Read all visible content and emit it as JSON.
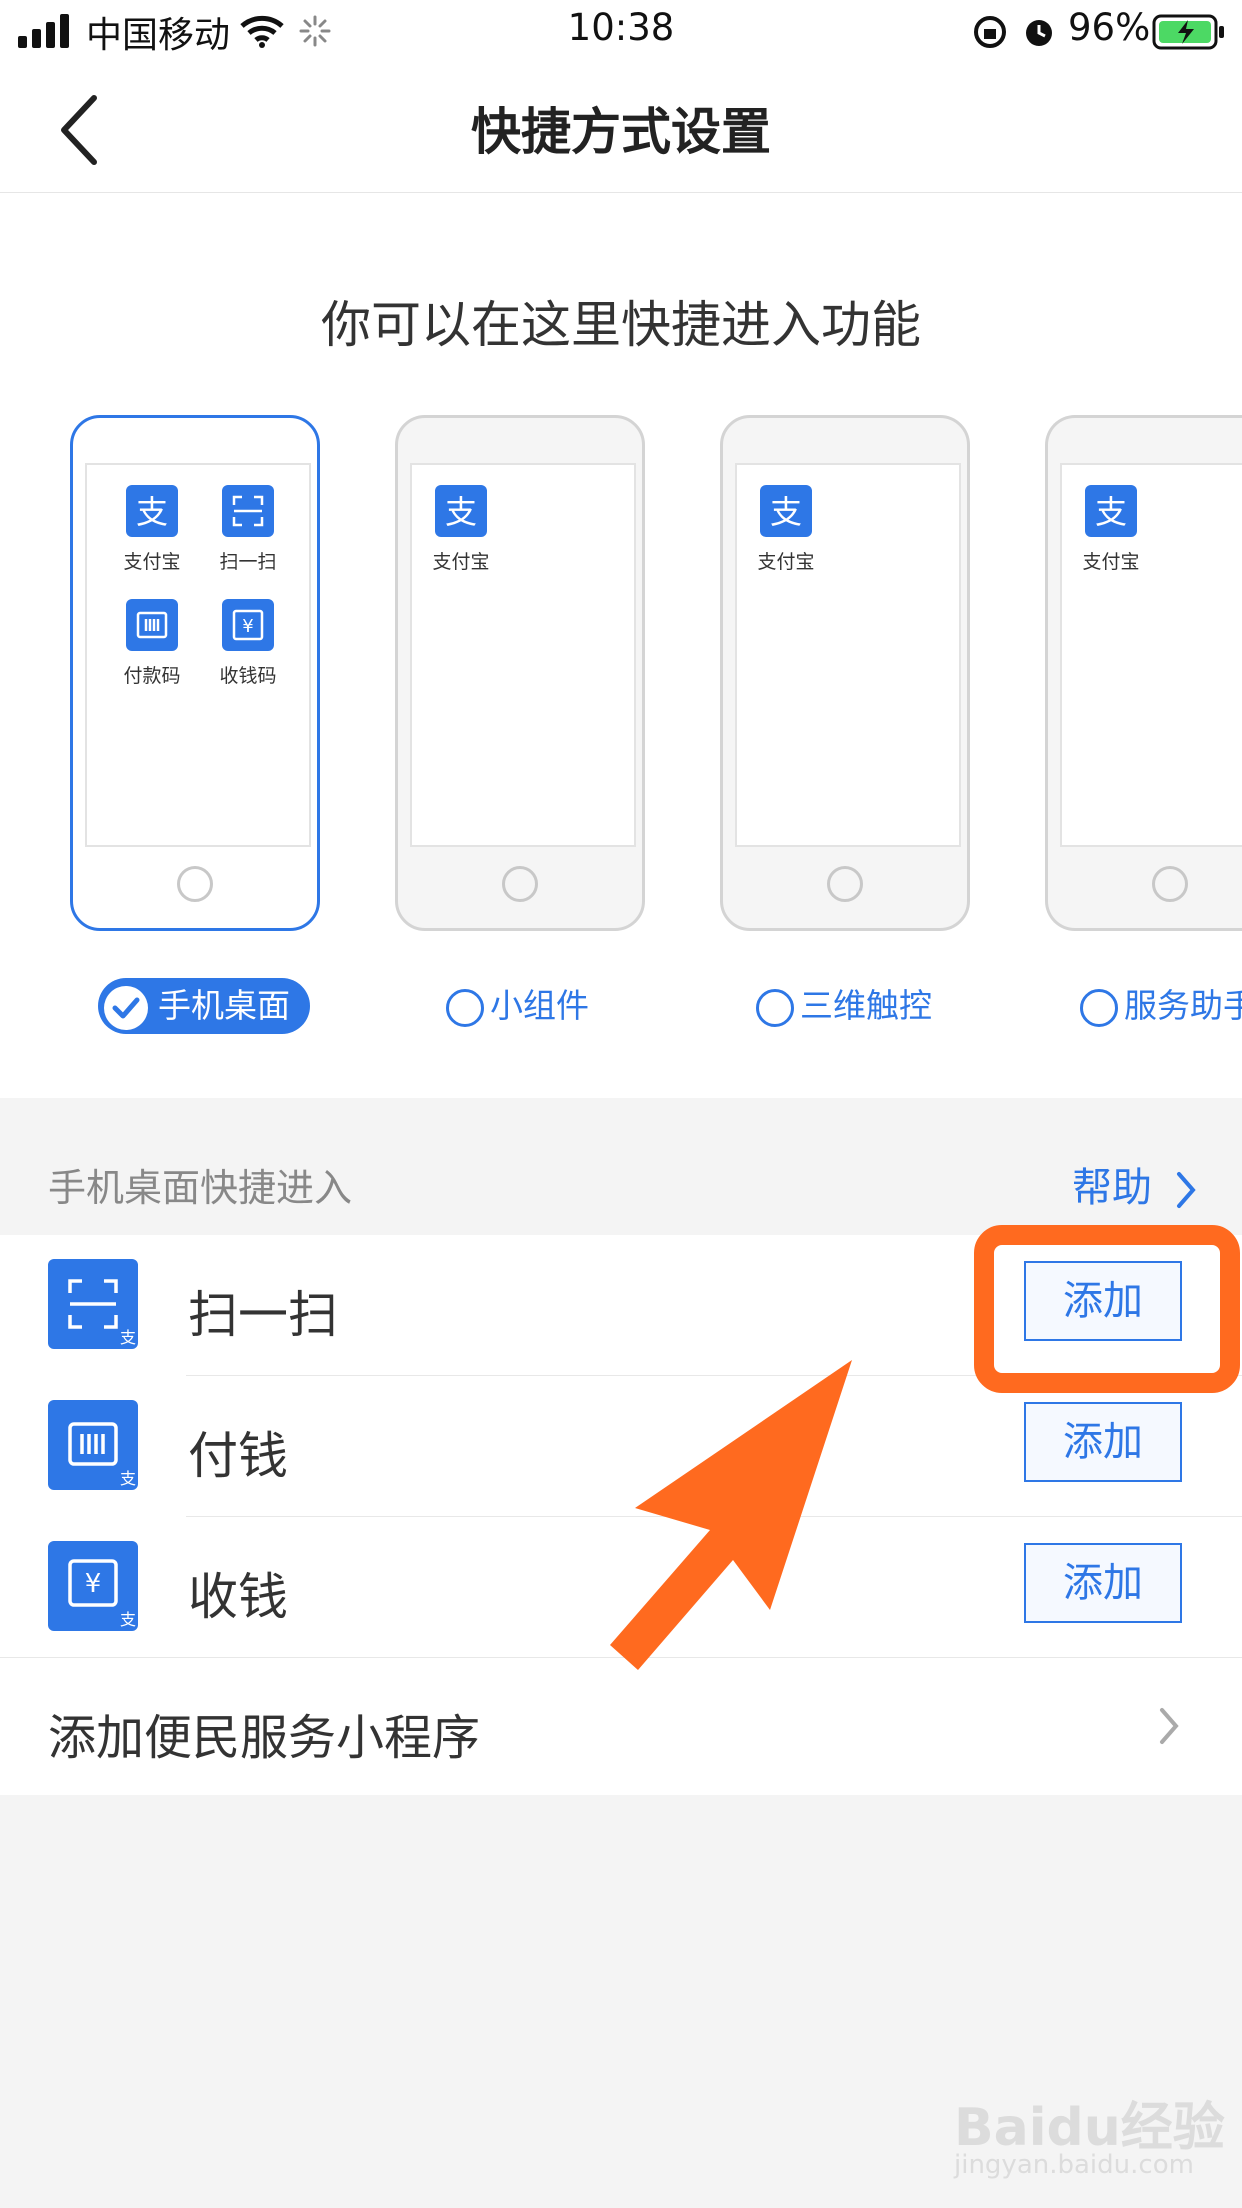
{
  "status": {
    "carrier": "中国移动",
    "time": "10:38",
    "battery": "96%"
  },
  "nav": {
    "title": "快捷方式设置"
  },
  "top": {
    "headline": "你可以在这里快捷进入功能",
    "phones": [
      {
        "apps": [
          {
            "label": "支付宝"
          },
          {
            "label": "扫一扫"
          },
          {
            "label": "付款码"
          },
          {
            "label": "收钱码"
          }
        ]
      },
      {
        "apps": [
          {
            "label": "支付宝"
          }
        ]
      },
      {
        "apps": [
          {
            "label": "支付宝"
          }
        ]
      },
      {
        "apps": [
          {
            "label": "支付宝"
          }
        ]
      }
    ],
    "options": [
      {
        "label": "手机桌面",
        "selected": true
      },
      {
        "label": "小组件",
        "selected": false
      },
      {
        "label": "三维触控",
        "selected": false
      },
      {
        "label": "服务助手",
        "selected": false
      }
    ]
  },
  "section": {
    "label": "手机桌面快捷进入",
    "help": "帮助"
  },
  "list": {
    "items": [
      {
        "name": "扫一扫",
        "action": "添加",
        "icon": "scan-icon"
      },
      {
        "name": "付钱",
        "action": "添加",
        "icon": "barcode-icon"
      },
      {
        "name": "收钱",
        "action": "添加",
        "icon": "yuan-icon"
      }
    ],
    "mini_program_link": "添加便民服务小程序"
  },
  "colors": {
    "accent": "#2e77e6",
    "highlight": "#ff6a1f"
  },
  "watermark": {
    "text": "Baidu经验",
    "sub": "jingyan.baidu.com"
  }
}
